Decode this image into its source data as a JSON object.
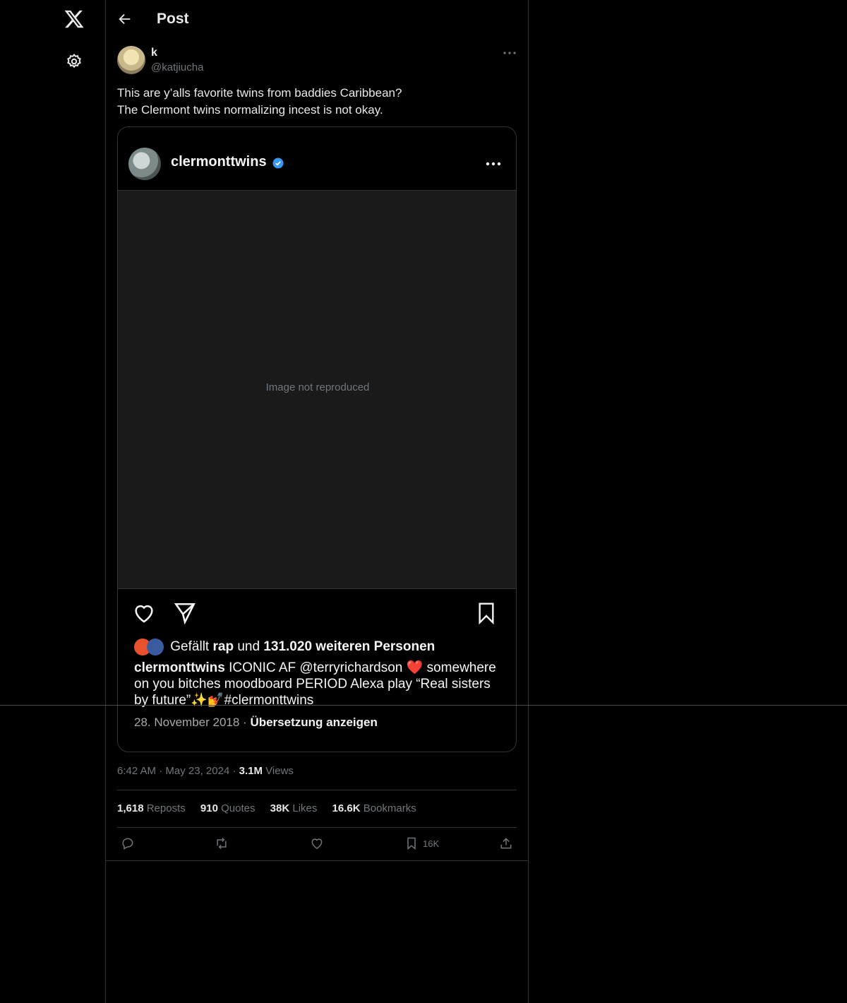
{
  "nav": {
    "logo_icon": "x-logo-icon",
    "settings_icon": "gear-icon"
  },
  "header": {
    "title": "Post"
  },
  "author": {
    "name": "k",
    "handle": "@katjiucha"
  },
  "tweet": {
    "line1": "This are y’alls favorite twins from baddies Caribbean?",
    "line2": "The Clermont twins normalizing incest is not okay."
  },
  "embed": {
    "username": "clermonttwins",
    "image_note": "Image not reproduced",
    "likes_prefix": "Gefällt ",
    "likes_user": "rap",
    "likes_mid": " und ",
    "likes_count": "131.020 weiteren Personen",
    "caption_user": "clermonttwins",
    "caption_text": " ICONIC AF @terryrichardson ",
    "caption_heart": "❤️",
    "caption_rest": " somewhere on you bitches moodboard PERIOD  Alexa play “Real sisters by future”✨💅#clermonttwins",
    "date": "28. November 2018",
    "separator": " · ",
    "translate": "Übersetzung anzeigen"
  },
  "meta": {
    "time": "6:42 AM",
    "dot": " · ",
    "date": "May 23, 2024",
    "views": "3.1M",
    "views_label": " Views"
  },
  "stats": {
    "reposts": "1,618",
    "reposts_label": " Reposts",
    "quotes": "910",
    "quotes_label": " Quotes",
    "likes": "38K",
    "likes_label": " Likes",
    "bookmarks": "16.6K",
    "bookmarks_label": " Bookmarks"
  },
  "actions": {
    "bookmark_count": "16K"
  }
}
